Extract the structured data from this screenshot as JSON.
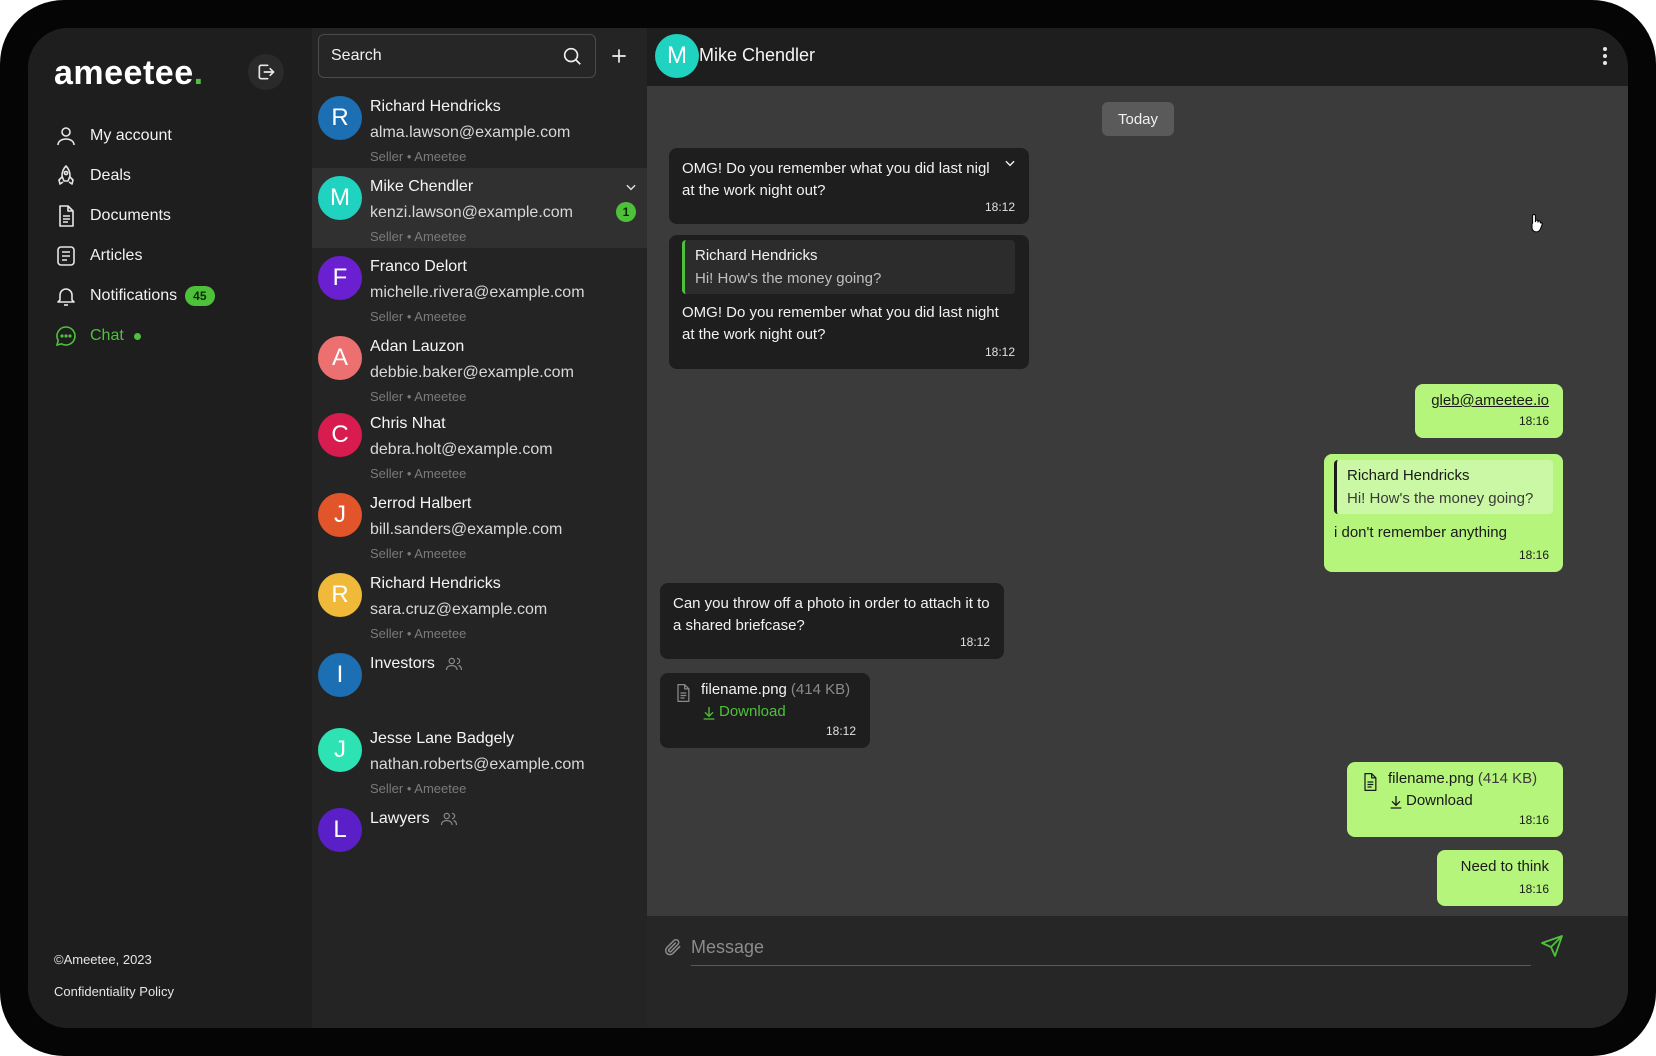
{
  "nav": {
    "logo": "ameetee",
    "logo_dot": ".",
    "items": [
      {
        "label": "My account",
        "icon": "user-icon"
      },
      {
        "label": "Deals",
        "icon": "rocket-icon"
      },
      {
        "label": "Documents",
        "icon": "document-icon"
      },
      {
        "label": "Articles",
        "icon": "article-icon"
      },
      {
        "label": "Notifications",
        "icon": "bell-icon",
        "badge": "45"
      },
      {
        "label": "Chat",
        "icon": "chat-icon",
        "active": true
      }
    ],
    "copyright": "©Ameetee, 2023",
    "policy": "Confidentiality Policy"
  },
  "search": {
    "placeholder": "Search"
  },
  "contacts": [
    {
      "initial": "R",
      "name": "Richard Hendricks",
      "email": "alma.lawson@example.com",
      "meta": "Seller • Ameetee",
      "color": "#1c6fb3"
    },
    {
      "initial": "M",
      "name": "Mike Chendler",
      "email": "kenzi.lawson@example.com",
      "meta": "Seller • Ameetee",
      "color": "#20d2c0",
      "unread": "1"
    },
    {
      "initial": "F",
      "name": "Franco Delort",
      "email": "michelle.rivera@example.com",
      "meta": "Seller • Ameetee",
      "color": "#6a1fd0"
    },
    {
      "initial": "A",
      "name": "Adan Lauzon",
      "email": "debbie.baker@example.com",
      "meta": "Seller • Ameetee",
      "color": "#ec7070"
    },
    {
      "initial": "C",
      "name": "Chris Nhat",
      "email": "debra.holt@example.com",
      "meta": "Seller • Ameetee",
      "color": "#d81c4f"
    },
    {
      "initial": "J",
      "name": "Jerrod Halbert",
      "email": "bill.sanders@example.com",
      "meta": "Seller • Ameetee",
      "color": "#e2552a"
    },
    {
      "initial": "R",
      "name": "Richard Hendricks",
      "email": "sara.cruz@example.com",
      "meta": "Seller • Ameetee",
      "color": "#f0b93a"
    },
    {
      "initial": "I",
      "name": "Investors",
      "group": true,
      "color": "#1c6fb3"
    },
    {
      "initial": "J",
      "name": "Jesse Lane Badgely",
      "email": "nathan.roberts@example.com",
      "meta": "Seller • Ameetee",
      "color": "#2ee3b3"
    },
    {
      "initial": "L",
      "name": "Lawyers",
      "group": true,
      "color": "#5b1fc8"
    }
  ],
  "chat": {
    "initial": "M",
    "title": "Mike Chendler",
    "day": "Today",
    "messages": {
      "m1": {
        "text": "OMG! Do you remember what you did last nigl at the work night out?",
        "time": "18:12"
      },
      "m2": {
        "reply_author": "Richard Hendricks",
        "reply_text": "Hi! How's the money going?",
        "text": "OMG! Do you remember what you did last night at the work night out?",
        "time": "18:12"
      },
      "m3": {
        "text": "gleb@ameetee.io",
        "time": "18:16"
      },
      "m4": {
        "reply_author": "Richard Hendricks",
        "reply_text": "Hi! How's the money going?",
        "text": "i don't remember anything",
        "time": "18:16"
      },
      "m5": {
        "text": "Can you throw off a photo in order to attach it to a shared briefcase?",
        "time": "18:12"
      },
      "m6": {
        "file": "filename.png",
        "size": "(414 KB)",
        "download": "Download",
        "time": "18:12"
      },
      "m7": {
        "file": "filename.png",
        "size": "(414 KB)",
        "download": "Download",
        "time": "18:16"
      },
      "m8": {
        "text": "Need to think",
        "time": "18:16"
      }
    },
    "composer_placeholder": "Message"
  },
  "colors": {
    "accent": "#4ec13a",
    "outgoing": "#b6f57c",
    "incoming": "#1e1e1e",
    "chat_bg": "#3b3b3b"
  }
}
